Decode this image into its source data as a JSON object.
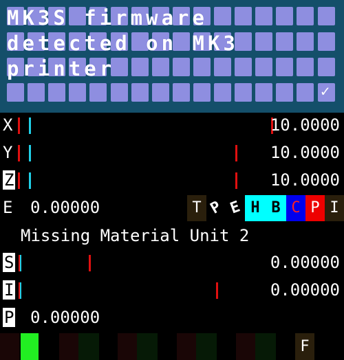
{
  "lcd": {
    "lines": [
      "MK3S firmware",
      "detected on MK3",
      "printer",
      ""
    ],
    "check_icon": "✓"
  },
  "axes": [
    {
      "label": "X",
      "value": "10.0000"
    },
    {
      "label": "Y",
      "value": "10.0000"
    },
    {
      "label": "Z",
      "value": "10.0000"
    }
  ],
  "extruder": {
    "label": "E",
    "value": "0.00000"
  },
  "status_badges": [
    "T",
    "P",
    "E",
    "H",
    "B",
    "C",
    "P",
    "I"
  ],
  "message": "Missing Material Unit 2",
  "s_row": {
    "label": "S",
    "value": "0.00000"
  },
  "i_row": {
    "label": "I",
    "value": "0.00000"
  },
  "p_row": {
    "label": "P",
    "value": "0.00000"
  },
  "footer": {
    "f_label": "F"
  },
  "colors": {
    "lcd_bg": "#144f6a",
    "lcd_cell": "#8e8ee0",
    "red": "#e01010",
    "cyan": "#20d0e8",
    "green": "#22ee22"
  }
}
